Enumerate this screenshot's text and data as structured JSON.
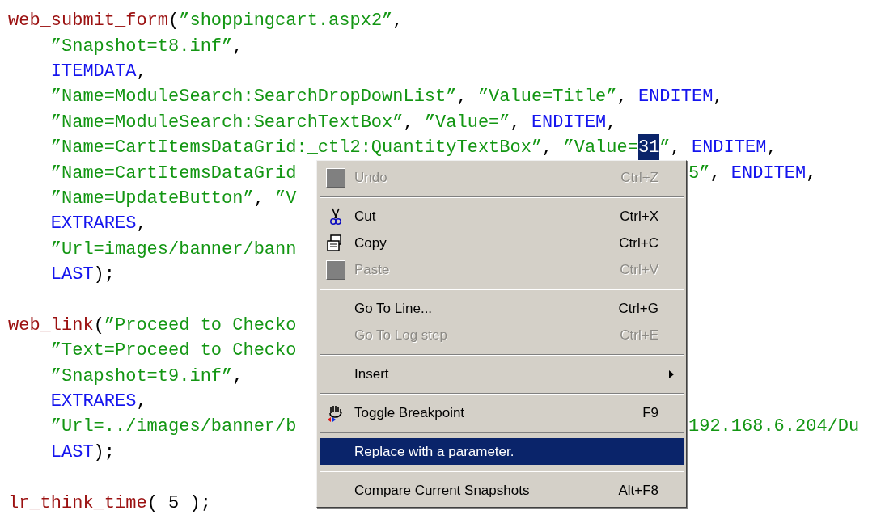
{
  "code_lines": [
    {
      "kind": "statement",
      "tokens": [
        {
          "kind": "func",
          "text": "web_submit_form"
        },
        {
          "kind": "plain",
          "text": "("
        },
        {
          "kind": "str",
          "text": "”shoppingcart.aspx2”"
        },
        {
          "kind": "plain",
          "text": ","
        }
      ]
    },
    {
      "kind": "arg",
      "tokens": [
        {
          "kind": "str",
          "text": "”Snapshot=t8.inf”"
        },
        {
          "kind": "plain",
          "text": ","
        }
      ]
    },
    {
      "kind": "arg",
      "tokens": [
        {
          "kind": "const",
          "text": "ITEMDATA"
        },
        {
          "kind": "plain",
          "text": ","
        }
      ]
    },
    {
      "kind": "arg",
      "tokens": [
        {
          "kind": "str",
          "text": "”Name=ModuleSearch:SearchDropDownList”"
        },
        {
          "kind": "plain",
          "text": ", "
        },
        {
          "kind": "str",
          "text": "”Value=Title”"
        },
        {
          "kind": "plain",
          "text": ", "
        },
        {
          "kind": "const",
          "text": "ENDITEM"
        },
        {
          "kind": "plain",
          "text": ","
        }
      ]
    },
    {
      "kind": "arg",
      "tokens": [
        {
          "kind": "str",
          "text": "”Name=ModuleSearch:SearchTextBox”"
        },
        {
          "kind": "plain",
          "text": ", "
        },
        {
          "kind": "str",
          "text": "”Value=”"
        },
        {
          "kind": "plain",
          "text": ", "
        },
        {
          "kind": "const",
          "text": "ENDITEM"
        },
        {
          "kind": "plain",
          "text": ","
        }
      ]
    },
    {
      "kind": "arg",
      "tokens": [
        {
          "kind": "str",
          "text": "”Name=CartItemsDataGrid:_ctl2:QuantityTextBox”"
        },
        {
          "kind": "plain",
          "text": ", "
        },
        {
          "kind": "str",
          "text": "”Value="
        },
        {
          "kind": "selection",
          "text": "31"
        },
        {
          "kind": "str",
          "text": "”"
        },
        {
          "kind": "plain",
          "text": ", "
        },
        {
          "kind": "const",
          "text": "ENDITEM"
        },
        {
          "kind": "plain",
          "text": ","
        }
      ]
    },
    {
      "kind": "arg_split",
      "tokens": [
        {
          "kind": "str",
          "text": "”Name=CartItemsDataGrid"
        }
      ],
      "right": [
        {
          "kind": "str",
          "text": "5”"
        },
        {
          "kind": "plain",
          "text": ", "
        },
        {
          "kind": "const",
          "text": "ENDITEM"
        },
        {
          "kind": "plain",
          "text": ","
        }
      ]
    },
    {
      "kind": "arg_split",
      "tokens": [
        {
          "kind": "str",
          "text": "”Name=UpdateButton”"
        },
        {
          "kind": "plain",
          "text": ", "
        },
        {
          "kind": "str",
          "text": "”V"
        }
      ]
    },
    {
      "kind": "arg_split",
      "tokens": [
        {
          "kind": "const",
          "text": "EXTRARES"
        },
        {
          "kind": "plain",
          "text": ","
        }
      ]
    },
    {
      "kind": "arg_split",
      "tokens": [
        {
          "kind": "str",
          "text": "”Url=images/banner/bann"
        }
      ]
    },
    {
      "kind": "arg_split",
      "tokens": [
        {
          "kind": "const",
          "text": "LAST"
        },
        {
          "kind": "plain",
          "text": ");"
        }
      ]
    },
    {
      "kind": "blank"
    },
    {
      "kind": "statement_split",
      "tokens": [
        {
          "kind": "func",
          "text": "web_link"
        },
        {
          "kind": "plain",
          "text": "("
        },
        {
          "kind": "str",
          "text": "”Proceed to Checko"
        }
      ]
    },
    {
      "kind": "arg_split",
      "tokens": [
        {
          "kind": "str",
          "text": "”Text=Proceed to Checko"
        }
      ]
    },
    {
      "kind": "arg_split",
      "tokens": [
        {
          "kind": "str",
          "text": "”Snapshot=t9.inf”"
        },
        {
          "kind": "plain",
          "text": ","
        }
      ]
    },
    {
      "kind": "arg_split",
      "tokens": [
        {
          "kind": "const",
          "text": "EXTRARES"
        },
        {
          "kind": "plain",
          "text": ","
        }
      ]
    },
    {
      "kind": "arg_split",
      "tokens": [
        {
          "kind": "str",
          "text": "”Url=../images/banner/b"
        }
      ],
      "right": [
        {
          "kind": "str",
          "text": "192.168.6.204/Du"
        }
      ]
    },
    {
      "kind": "arg_split",
      "tokens": [
        {
          "kind": "const",
          "text": "LAST"
        },
        {
          "kind": "plain",
          "text": ");"
        }
      ]
    },
    {
      "kind": "blank"
    },
    {
      "kind": "statement",
      "tokens": [
        {
          "kind": "func",
          "text": "lr_think_time"
        },
        {
          "kind": "plain",
          "text": "( 5 );"
        }
      ]
    }
  ],
  "context_menu": [
    {
      "kind": "item",
      "label": "Undo",
      "shortcut": "Ctrl+Z",
      "disabled": true,
      "selected": false
    },
    {
      "kind": "separator"
    },
    {
      "kind": "item",
      "label": "Cut",
      "shortcut": "Ctrl+X",
      "disabled": false,
      "selected": false
    },
    {
      "kind": "item",
      "label": "Copy",
      "shortcut": "Ctrl+C",
      "disabled": false,
      "selected": false
    },
    {
      "kind": "item",
      "label": "Paste",
      "shortcut": "Ctrl+V",
      "disabled": true,
      "selected": false
    },
    {
      "kind": "separator"
    },
    {
      "kind": "item",
      "label": "Go To Line...",
      "shortcut": "Ctrl+G",
      "disabled": false,
      "selected": false
    },
    {
      "kind": "item",
      "label": "Go To Log step",
      "shortcut": "Ctrl+E",
      "disabled": true,
      "selected": false
    },
    {
      "kind": "separator"
    },
    {
      "kind": "submenu",
      "label": "Insert",
      "disabled": false,
      "selected": false
    },
    {
      "kind": "separator"
    },
    {
      "kind": "item",
      "label": "Toggle Breakpoint",
      "shortcut": "F9",
      "disabled": false,
      "selected": false
    },
    {
      "kind": "separator"
    },
    {
      "kind": "item",
      "label": "Replace with a parameter.",
      "disabled": false,
      "selected": true
    },
    {
      "kind": "separator"
    },
    {
      "kind": "item",
      "label": "Compare Current Snapshots",
      "shortcut": "Alt+F8",
      "disabled": false,
      "selected": false
    }
  ]
}
